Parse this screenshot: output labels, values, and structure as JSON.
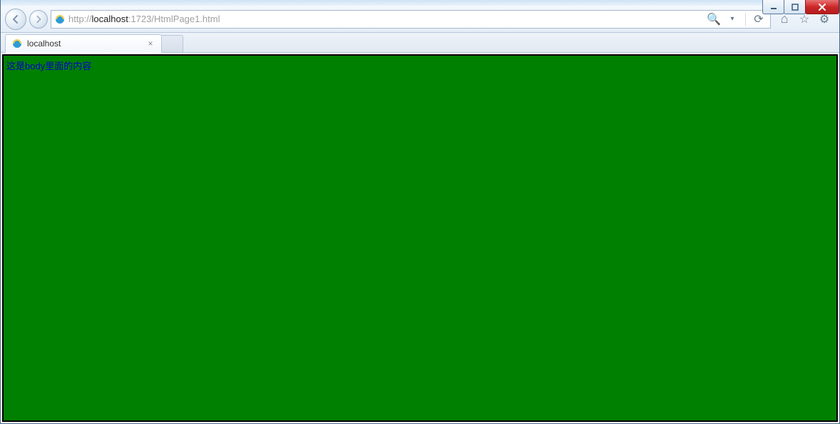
{
  "window": {
    "controls": {
      "minimize": "minimize",
      "maximize": "maximize",
      "close": "close"
    }
  },
  "address_bar": {
    "url_prefix": "http://",
    "url_host": "localhost",
    "url_port_path": ":1723/HtmlPage1.html",
    "search_glyph": "🔍",
    "dropdown_glyph": "▾",
    "refresh_glyph": "⟳"
  },
  "right_tools": {
    "home": "⌂",
    "favorites": "☆",
    "tools": "⚙"
  },
  "tab": {
    "title": "localhost",
    "close": "×"
  },
  "page": {
    "body_text": "这是body里面的内容",
    "background_color": "#008000",
    "text_color": "#0000cc"
  }
}
